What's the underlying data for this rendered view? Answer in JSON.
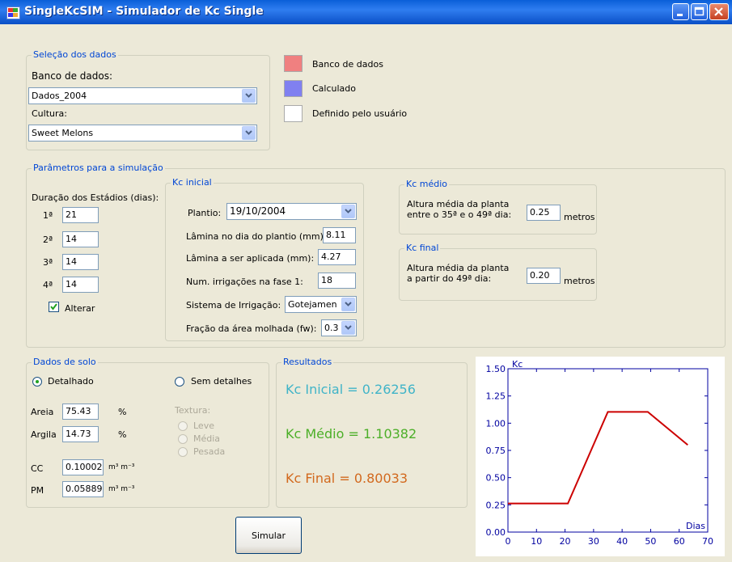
{
  "window": {
    "title": "SingleKcSIM - Simulador de Kc Single"
  },
  "selecao": {
    "legend": "Seleção dos dados",
    "banco_label": "Banco de dados:",
    "banco_value": "Dados_2004",
    "cultura_label": "Cultura:",
    "cultura_value": "Sweet Melons"
  },
  "legend_key": {
    "items": [
      {
        "label": "Banco de dados",
        "color": "#f08080"
      },
      {
        "label": "Calculado",
        "color": "#8080f0"
      },
      {
        "label": "Definido pelo usuário",
        "color": "#ffffff"
      }
    ]
  },
  "parametros": {
    "legend": "Parâmetros para a simulação",
    "duracao_label": "Duração dos Estádios (dias):",
    "stages": [
      {
        "label": "1ª",
        "value": "21"
      },
      {
        "label": "2ª",
        "value": "14"
      },
      {
        "label": "3ª",
        "value": "14"
      },
      {
        "label": "4ª",
        "value": "14"
      }
    ],
    "alterar_label": "Alterar",
    "alterar_checked": true,
    "kc_inicial": {
      "legend": "Kc inicial",
      "plantio_label": "Plantio:",
      "plantio_value": "19/10/2004",
      "lamina_plantio_label": "Lâmina no dia do plantio (mm):",
      "lamina_plantio_value": "8.11",
      "lamina_aplicada_label": "Lâmina a ser aplicada (mm):",
      "lamina_aplicada_value": "4.27",
      "num_irrig_label": "Num. irrigações na fase 1:",
      "num_irrig_value": "18",
      "sistema_label": "Sistema de Irrigação:",
      "sistema_value": "Gotejamen",
      "fracao_label": "Fração da área molhada (fw):",
      "fracao_value": "0.3"
    },
    "kc_medio": {
      "legend": "Kc médio",
      "line1": "Altura média da planta",
      "line2": "entre o 35ª e o 49ª dia:",
      "value": "0.25",
      "unit": "metros"
    },
    "kc_final": {
      "legend": "Kc final",
      "line1": "Altura média da planta",
      "line2": "a partir do 49ª dia:",
      "value": "0.20",
      "unit": "metros"
    }
  },
  "solo": {
    "legend": "Dados de solo",
    "detalhado_label": "Detalhado",
    "sem_detalhes_label": "Sem detalhes",
    "areia_label": "Areia",
    "areia_value": "75.43",
    "argila_label": "Argila",
    "argila_value": "14.73",
    "pct": "%",
    "textura_label": "Textura:",
    "textura_options": [
      "Leve",
      "Média",
      "Pesada"
    ],
    "cc_label": "CC",
    "cc_value": "0.10002",
    "pm_label": "PM",
    "pm_value": "0.05889",
    "unit": "m³ m⁻³"
  },
  "resultados": {
    "legend": "Resultados",
    "kc_inicial": "Kc Inicial = 0.26256",
    "kc_medio": "Kc Médio = 1.10382",
    "kc_final": "Kc Final = 0.80033",
    "colors": {
      "inicial": "#40b4c8",
      "medio": "#4caf28",
      "final": "#d2691e"
    }
  },
  "simular_label": "Simular",
  "chart_data": {
    "type": "line",
    "ylabel": "Kc",
    "xlabel": "Dias",
    "xlim": [
      0,
      70
    ],
    "ylim": [
      0,
      1.5
    ],
    "xticks": [
      0,
      10,
      20,
      30,
      40,
      50,
      60,
      70
    ],
    "yticks": [
      0,
      0.25,
      0.5,
      0.75,
      1.0,
      1.25,
      1.5
    ],
    "ytick_labels": [
      "0.00",
      "0.25",
      "0.50",
      "0.75",
      "1.00",
      "1.25",
      "1.50"
    ],
    "series": [
      {
        "x": [
          0,
          21,
          35,
          49,
          63
        ],
        "y": [
          0.26256,
          0.26256,
          1.10382,
          1.10382,
          0.80033
        ],
        "color": "#cc0000"
      }
    ]
  }
}
